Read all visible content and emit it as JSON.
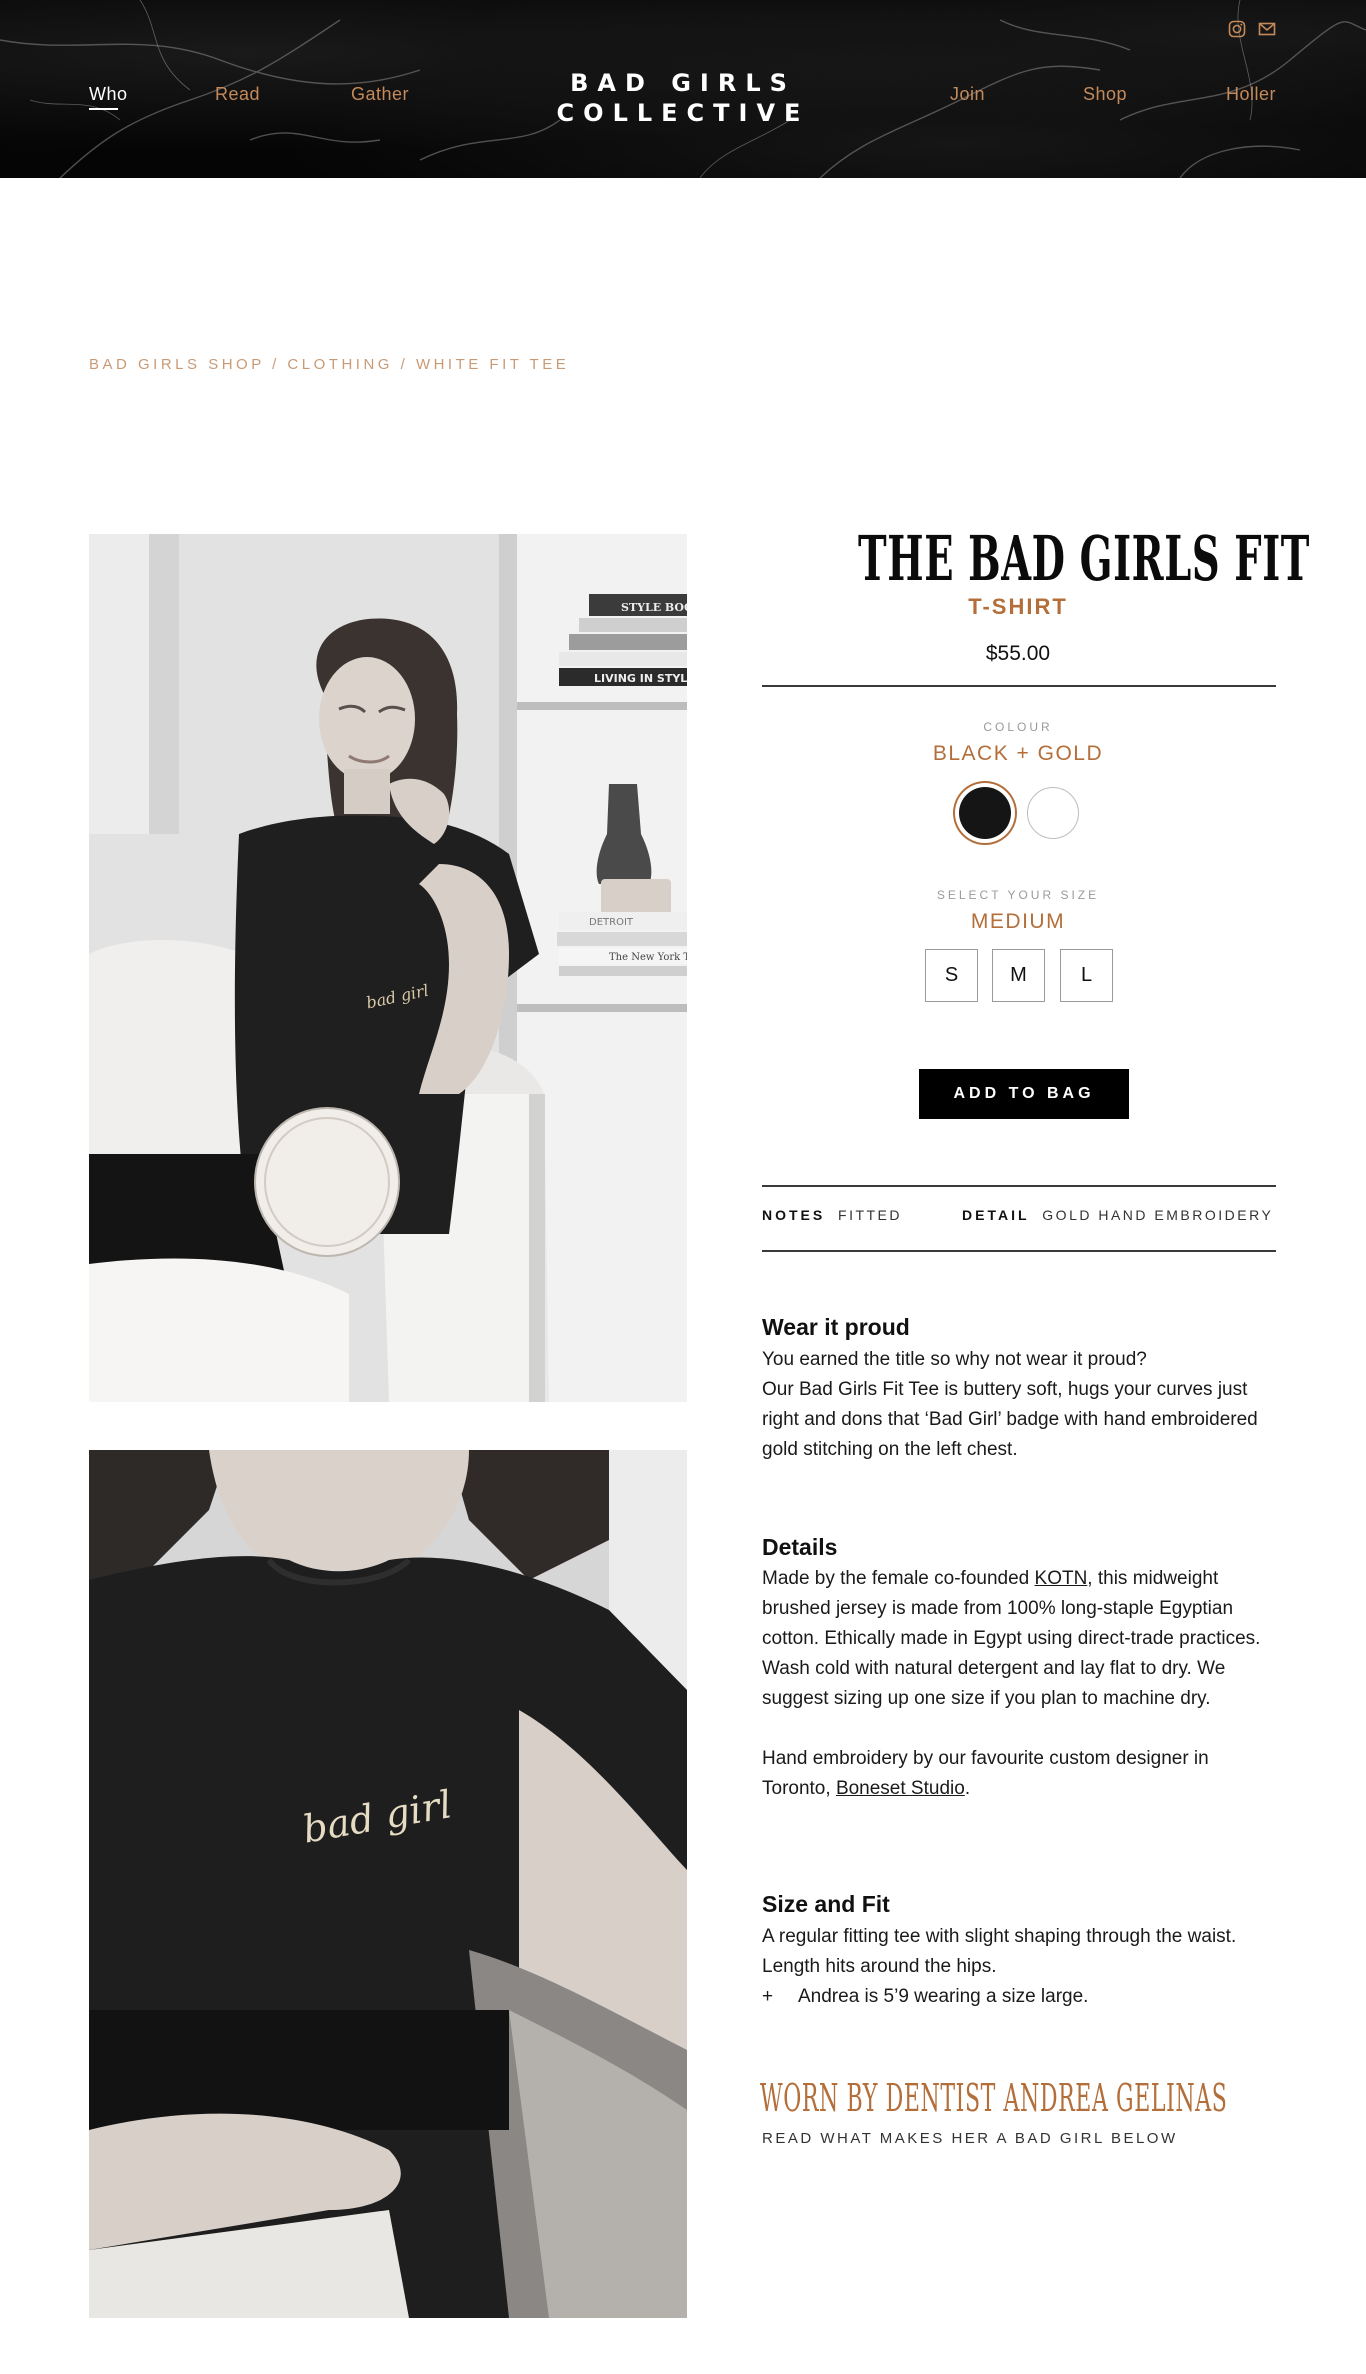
{
  "nav": {
    "left": [
      "Who",
      "Read",
      "Gather"
    ],
    "right": [
      "Join",
      "Shop",
      "Holler"
    ],
    "logo_line1": "BAD GIRLS",
    "logo_line2": "COLLECTIVE"
  },
  "social": [
    "instagram-icon",
    "mail-icon"
  ],
  "breadcrumb": "BAD GIRLS SHOP / CLOTHING / WHITE FIT TEE",
  "product": {
    "title": "THE BAD GIRLS FIT",
    "subtitle": "T-SHIRT",
    "price": "$55.00",
    "colour_label": "COLOUR",
    "colour_value": "BLACK + GOLD",
    "colours": [
      "#151515",
      "#ffffff"
    ],
    "size_label": "SELECT YOUR SIZE",
    "size_value": "MEDIUM",
    "sizes": [
      "S",
      "M",
      "L"
    ],
    "add_to_bag": "ADD TO BAG",
    "notes_label": "NOTES",
    "notes_value": "FITTED",
    "detail_label": "DETAIL",
    "detail_value": "GOLD HAND EMBROIDERY"
  },
  "sections": {
    "wear": {
      "heading": "Wear it proud",
      "line1": "You earned the title so why not wear it proud?",
      "line2": "Our Bad Girls Fit Tee is buttery soft, hugs your curves just right and dons that ‘Bad Girl’ badge with hand embroidered gold stitching on the left chest."
    },
    "details": {
      "heading": "Details",
      "p1_before": "Made by the female co-founded ",
      "p1_link": "KOTN",
      "p1_after": ", this midweight brushed jersey is made from 100% long-staple Egyptian cotton. Ethically made in Egypt using direct-trade practices. Wash cold with natural detergent and lay flat to dry. We suggest sizing up one size if you plan to machine dry.",
      "p2_before": "Hand embroidery by our favourite custom designer in Toronto, ",
      "p2_link": "Boneset Studio",
      "p2_after": "."
    },
    "size_fit": {
      "heading": "Size and Fit",
      "body": "A regular fitting tee with slight shaping through the waist. Length hits around the hips.",
      "bullet": "+",
      "bullet_text": "Andrea is 5’9 wearing a size large."
    }
  },
  "worn": {
    "title": "WORN BY DENTIST ANDREA GELINAS",
    "subtitle": "READ WHAT MAKES HER A BAD GIRL BELOW"
  },
  "photos": {
    "embroidery": "bad girl",
    "books": [
      "STYLE BOO",
      "LIVING IN STYL",
      "DETROIT",
      "The New York Times"
    ]
  },
  "colors": {
    "accent": "#b36e3a",
    "nav_link": "#c58a5a",
    "breadcrumb": "#c99a76"
  }
}
